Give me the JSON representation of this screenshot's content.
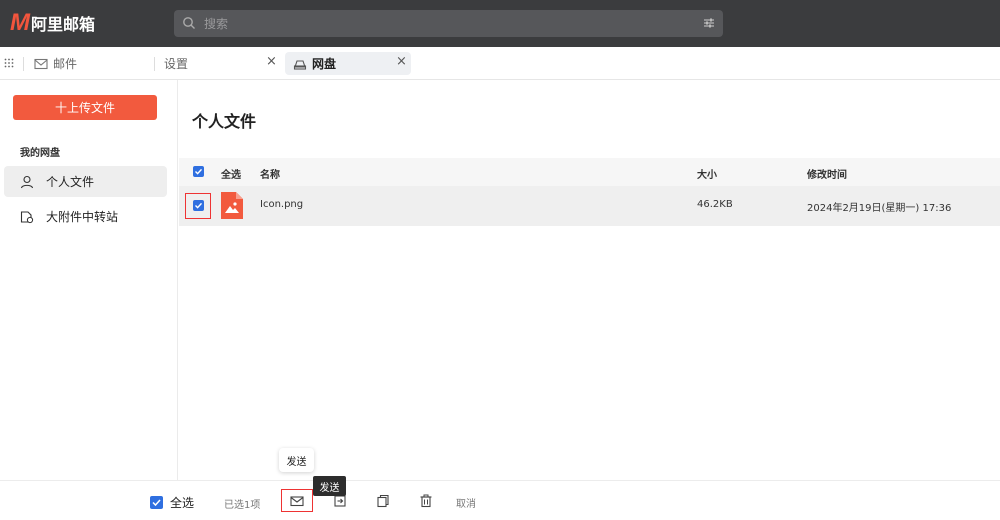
{
  "app": {
    "logo_letter": "M",
    "logo_text": "阿里邮箱"
  },
  "search": {
    "placeholder": "搜索",
    "icon": "search-icon",
    "filter_icon": "filter-sliders-icon"
  },
  "tabs": [
    {
      "label": "邮件",
      "icon": "mail-icon"
    },
    {
      "label": "设置",
      "close": "×"
    },
    {
      "label": "网盘",
      "icon": "cloud-drive-icon",
      "close": "×",
      "active": true
    }
  ],
  "sidebar": {
    "upload_label": "十上传文件",
    "section_title": "我的网盘",
    "items": [
      {
        "label": "个人文件",
        "icon": "user-icon",
        "active": true
      },
      {
        "label": "大附件中转站",
        "icon": "large-attachment-icon"
      }
    ]
  },
  "main": {
    "title": "个人文件",
    "columns": {
      "select_all": "全选",
      "name": "名称",
      "size": "大小",
      "modified": "修改时间"
    },
    "rows": [
      {
        "name": "Icon.png",
        "size": "46.2KB",
        "modified": "2024年2月19日(星期一) 17:36",
        "checked": true,
        "icon": "image-file-icon"
      }
    ]
  },
  "bottom": {
    "select_all": "全选",
    "selected_count": "已选1项",
    "actions": [
      {
        "icon": "send-mail-icon",
        "tooltip": "发送"
      },
      {
        "icon": "move-icon"
      },
      {
        "icon": "copy-icon"
      },
      {
        "icon": "trash-icon"
      }
    ],
    "cancel": "取消",
    "tooltip_hover": "发送",
    "tooltip_dark": "发送"
  },
  "colors": {
    "accent": "#f25a3e",
    "checkbox": "#2f6fe0",
    "topbar": "#3b3c3e",
    "highlight_frame": "#ee3333"
  }
}
